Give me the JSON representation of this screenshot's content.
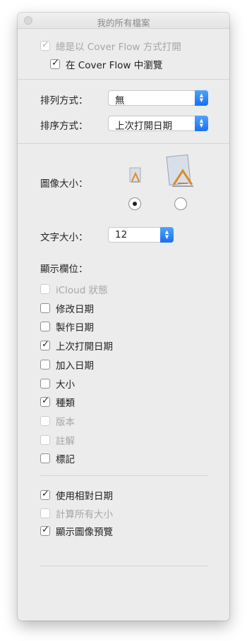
{
  "window": {
    "title": "我的所有檔案"
  },
  "top_options": [
    {
      "label": "總是以 Cover Flow 方式打開",
      "checked": true,
      "enabled": false
    },
    {
      "label": "在 Cover Flow 中瀏覽",
      "checked": true,
      "enabled": true
    }
  ],
  "arrange": {
    "label": "排列方式：",
    "value": "無"
  },
  "sort": {
    "label": "排序方式：",
    "value": "上次打開日期"
  },
  "icon_size": {
    "label": "圖像大小：",
    "selected": "small"
  },
  "text_size": {
    "label": "文字大小：",
    "value": "12"
  },
  "columns_heading": "顯示欄位：",
  "columns": [
    {
      "label": "iCloud 狀態",
      "checked": false,
      "enabled": false
    },
    {
      "label": "修改日期",
      "checked": false,
      "enabled": true
    },
    {
      "label": "製作日期",
      "checked": false,
      "enabled": true
    },
    {
      "label": "上次打開日期",
      "checked": true,
      "enabled": true
    },
    {
      "label": "加入日期",
      "checked": false,
      "enabled": true
    },
    {
      "label": "大小",
      "checked": false,
      "enabled": true
    },
    {
      "label": "種類",
      "checked": true,
      "enabled": true
    },
    {
      "label": "版本",
      "checked": false,
      "enabled": false
    },
    {
      "label": "註解",
      "checked": false,
      "enabled": false
    },
    {
      "label": "標記",
      "checked": false,
      "enabled": true
    }
  ],
  "bottom_options": [
    {
      "label": "使用相對日期",
      "checked": true,
      "enabled": true
    },
    {
      "label": "計算所有大小",
      "checked": false,
      "enabled": false
    },
    {
      "label": "顯示圖像預覽",
      "checked": true,
      "enabled": true
    }
  ],
  "icons": {
    "close": "close-dot-icon",
    "stepper": "up-down-arrows-icon",
    "small_preview": "document-icon-small",
    "large_preview": "document-icon-large"
  }
}
